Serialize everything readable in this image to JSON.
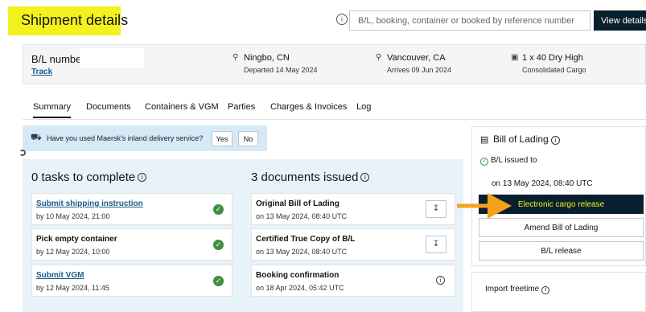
{
  "header": {
    "title": "Shipment details",
    "search_placeholder": "B/L, booking, container or booked by reference number",
    "view_button": "View details"
  },
  "summary": {
    "bl_label": "B/L number",
    "track_link": "Track",
    "origin": {
      "city": "Ningbo, CN",
      "note": "Departed 14 May 2024"
    },
    "destination": {
      "city": "Vancouver, CA",
      "note": "Arrives 09 Jun 2024"
    },
    "cargo": {
      "container": "1 x 40 Dry High",
      "note": "Consolidated Cargo"
    }
  },
  "tabs": [
    {
      "label": "Summary",
      "active": true
    },
    {
      "label": "Documents"
    },
    {
      "label": "Containers & VGM"
    },
    {
      "label": "Parties"
    },
    {
      "label": "Charges & Invoices"
    },
    {
      "label": "Log"
    }
  ],
  "banner": {
    "question": "Have you used Maersk's inland delivery service?",
    "yes": "Yes",
    "no": "No"
  },
  "tasks": {
    "heading": "0 tasks to complete",
    "items": [
      {
        "title": "Submit shipping instruction",
        "date": "by 10 May 2024, 21:00",
        "link": true
      },
      {
        "title": "Pick empty container",
        "date": "by 12 May 2024, 10:00",
        "link": false
      },
      {
        "title": "Submit VGM",
        "date": "by 12 May 2024, 11:45",
        "link": true
      }
    ]
  },
  "documents": {
    "heading": "3 documents issued",
    "items": [
      {
        "title": "Original Bill of Lading",
        "date": "on 13 May 2024, 08:40 UTC"
      },
      {
        "title": "Certified True Copy of B/L",
        "date": "on 13 May 2024, 08:40 UTC"
      },
      {
        "title": "Booking confirmation",
        "date": "on 18 Apr 2024, 05:42 UTC"
      }
    ]
  },
  "bill_of_lading": {
    "heading": "Bill of Lading",
    "status": "B/L issued to",
    "date": "on 13 May 2024, 08:40 UTC",
    "release_button": "Electronic cargo release",
    "amend_button": "Amend Bill of Lading",
    "bl_release_button": "B/L release"
  },
  "freetime": {
    "heading": "Import freetime"
  },
  "colors": {
    "highlight": "#f3f21f",
    "navy": "#0a1f2e",
    "arrow": "#f4a21b",
    "panel": "#e8f2f9",
    "check": "#3f8f44",
    "link": "#1a5b86"
  }
}
